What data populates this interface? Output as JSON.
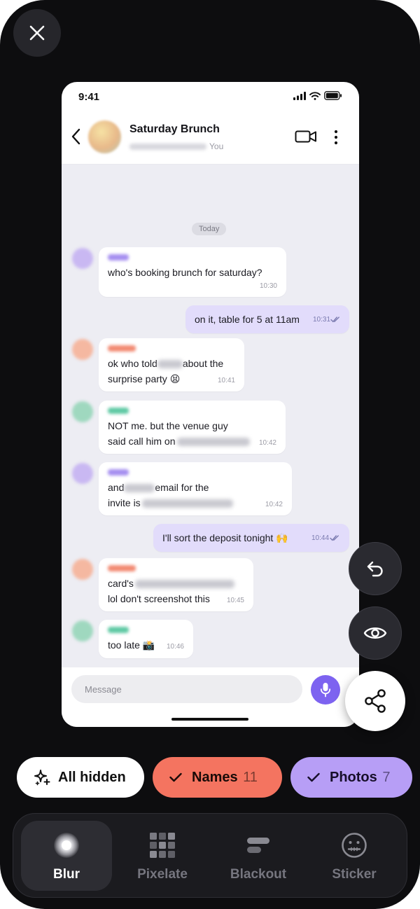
{
  "status_bar": {
    "time": "9:41"
  },
  "chat": {
    "title": "Saturday Brunch",
    "subtitle_suffix": "You",
    "date_chip": "Today",
    "composer_placeholder": "Message"
  },
  "messages": [
    {
      "dir": "in",
      "line1": "who's booking brunch for saturday?",
      "time": "10:30",
      "sender_color": "#a58ef0"
    },
    {
      "dir": "out",
      "line1": "on it, table for 5 at 11am",
      "time": "10:31"
    },
    {
      "dir": "in",
      "line1_a": "ok who told",
      "line1_b": "about the",
      "line2": "surprise party 😫",
      "time": "10:41",
      "sender_color": "#f28a72"
    },
    {
      "dir": "in",
      "line1": "NOT me. but the venue guy",
      "line2": "said call him on",
      "time": "10:42",
      "sender_color": "#5fc9a4"
    },
    {
      "dir": "in",
      "line1_a": "and",
      "line1_b": "email for the",
      "line2": "invite is",
      "time": "10:42",
      "sender_color": "#a58ef0"
    },
    {
      "dir": "out",
      "line1": "I'll sort the deposit tonight 🙌",
      "time": "10:44"
    },
    {
      "dir": "in",
      "line1": "card's",
      "line2": "lol don't screenshot this",
      "time": "10:45",
      "sender_color": "#f28a72"
    },
    {
      "dir": "in",
      "line1": "too late 📸",
      "time": "10:46",
      "sender_color": "#5fc9a4"
    }
  ],
  "chips": {
    "all_hidden": "All hidden",
    "names": "Names",
    "names_count": "11",
    "photos": "Photos",
    "photos_count": "7"
  },
  "tools": {
    "blur": "Blur",
    "pixelate": "Pixelate",
    "blackout": "Blackout",
    "sticker": "Sticker",
    "active": "Blur"
  },
  "icons": {
    "close": "close-icon",
    "undo": "undo-icon",
    "preview": "eye-icon",
    "share": "share-icon",
    "mic": "mic-icon",
    "video": "video-call-icon",
    "more": "more-vertical-icon"
  },
  "colors": {
    "names_chip": "#f47460",
    "photos_chip": "#b79ef6",
    "accent": "#7d63f0",
    "outgoing_bubble": "#e2dcfb"
  }
}
